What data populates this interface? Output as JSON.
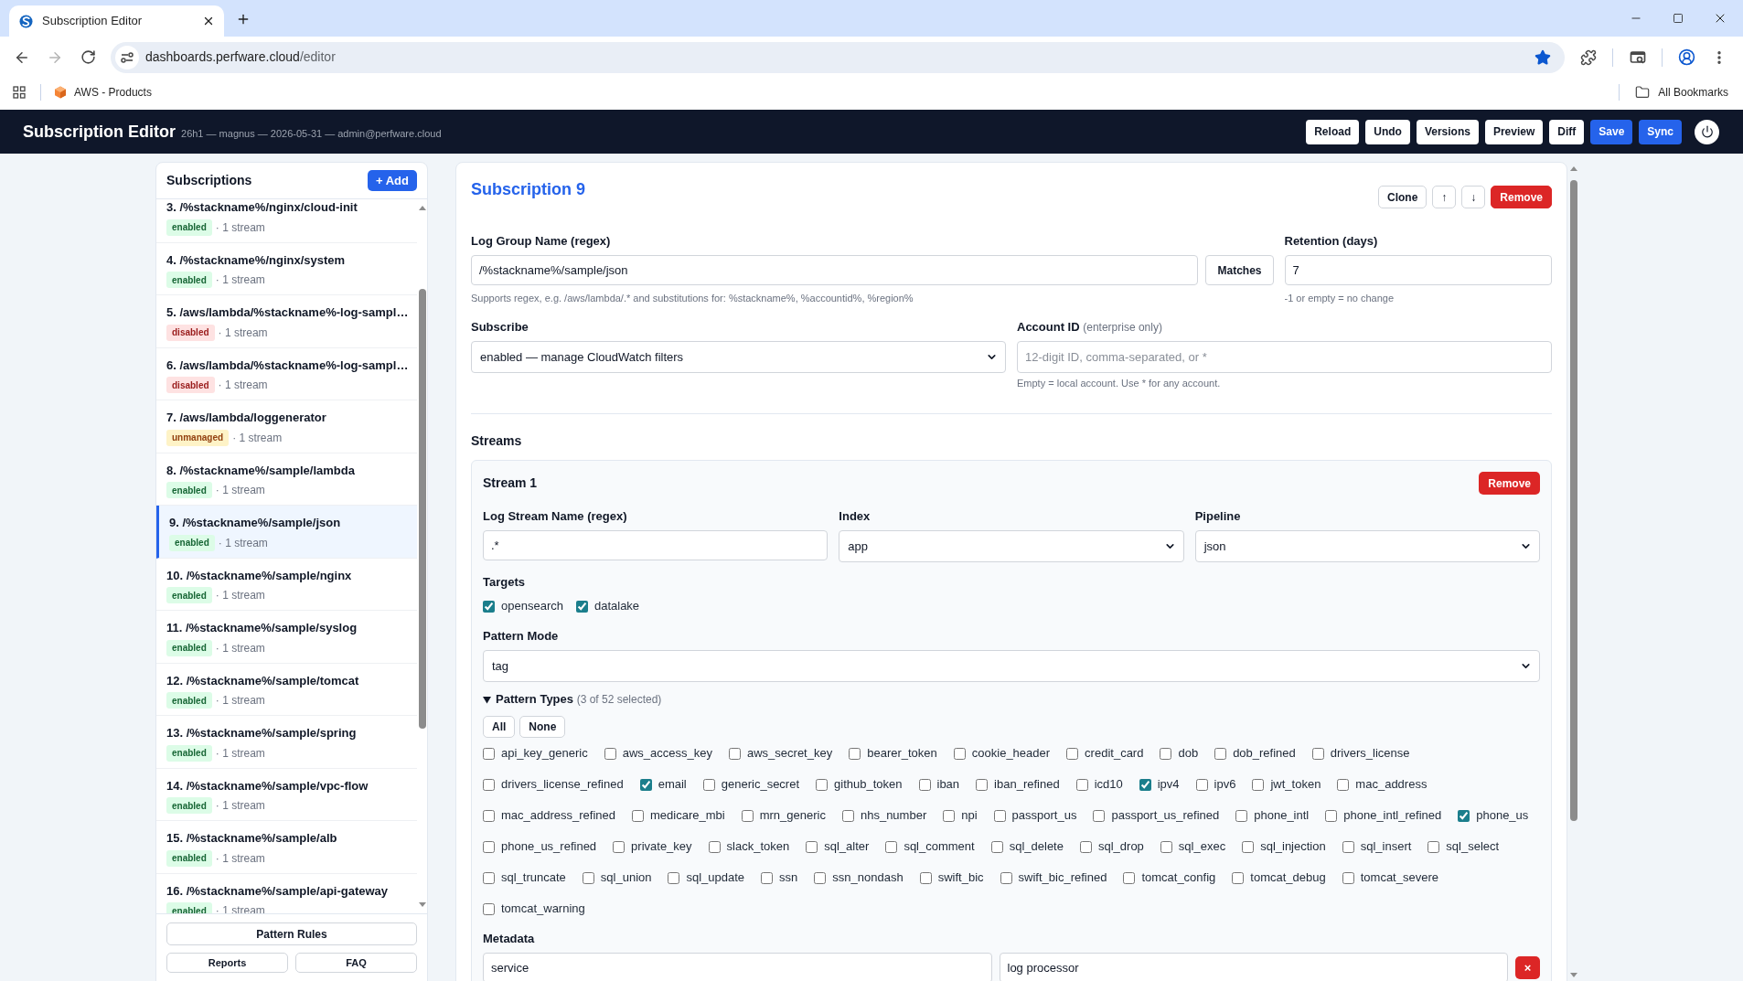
{
  "browser": {
    "tab": {
      "title": "Subscription Editor",
      "selected": true
    },
    "forward_disabled": true,
    "address": {
      "host": "dashboards.perfware.cloud",
      "path": "/editor"
    },
    "bookmarked": true,
    "bookmarks": [
      "AWS - Products"
    ],
    "all_bookmarks": "All Bookmarks"
  },
  "header": {
    "title": "Subscription Editor",
    "meta": "26h1 — magnus — 2026-05-31 — admin@perfware.cloud",
    "buttons": [
      {
        "label": "Reload",
        "kind": "secondary"
      },
      {
        "label": "Undo",
        "kind": "secondary"
      },
      {
        "label": "Versions",
        "kind": "secondary"
      },
      {
        "label": "Preview",
        "kind": "secondary"
      },
      {
        "label": "Diff",
        "kind": "secondary"
      },
      {
        "label": "Save",
        "kind": "primary"
      },
      {
        "label": "Sync",
        "kind": "primary"
      }
    ]
  },
  "sidebar": {
    "title": "Subscriptions",
    "add_button": "+ Add",
    "items": [
      {
        "title": "3. /%stackname%/nginx/cloud-init",
        "status": {
          "label": "enabled",
          "kind": "success"
        },
        "streams": "· 1 stream",
        "selected": false
      },
      {
        "title": "4. /%stackname%/nginx/system",
        "status": {
          "label": "enabled",
          "kind": "success"
        },
        "streams": "· 1 stream",
        "selected": false
      },
      {
        "title": "5. /aws/lambda/%stackname%-log-sampl…",
        "status": {
          "label": "disabled",
          "kind": "danger"
        },
        "streams": "· 1 stream",
        "selected": false
      },
      {
        "title": "6. /aws/lambda/%stackname%-log-sampl…",
        "status": {
          "label": "disabled",
          "kind": "danger"
        },
        "streams": "· 1 stream",
        "selected": false
      },
      {
        "title": "7. /aws/lambda/loggenerator",
        "status": {
          "label": "unmanaged",
          "kind": "warning"
        },
        "streams": "· 1 stream",
        "selected": false
      },
      {
        "title": "8. /%stackname%/sample/lambda",
        "status": {
          "label": "enabled",
          "kind": "success"
        },
        "streams": "· 1 stream",
        "selected": false
      },
      {
        "title": "9. /%stackname%/sample/json",
        "status": {
          "label": "enabled",
          "kind": "success"
        },
        "streams": "· 1 stream",
        "selected": true
      },
      {
        "title": "10. /%stackname%/sample/nginx",
        "status": {
          "label": "enabled",
          "kind": "success"
        },
        "streams": "· 1 stream",
        "selected": false
      },
      {
        "title": "11. /%stackname%/sample/syslog",
        "status": {
          "label": "enabled",
          "kind": "success"
        },
        "streams": "· 1 stream",
        "selected": false
      },
      {
        "title": "12. /%stackname%/sample/tomcat",
        "status": {
          "label": "enabled",
          "kind": "success"
        },
        "streams": "· 1 stream",
        "selected": false
      },
      {
        "title": "13. /%stackname%/sample/spring",
        "status": {
          "label": "enabled",
          "kind": "success"
        },
        "streams": "· 1 stream",
        "selected": false
      },
      {
        "title": "14. /%stackname%/sample/vpc-flow",
        "status": {
          "label": "enabled",
          "kind": "success"
        },
        "streams": "· 1 stream",
        "selected": false
      },
      {
        "title": "15. /%stackname%/sample/alb",
        "status": {
          "label": "enabled",
          "kind": "success"
        },
        "streams": "· 1 stream",
        "selected": false
      },
      {
        "title": "16. /%stackname%/sample/api-gateway",
        "status": {
          "label": "enabled",
          "kind": "success"
        },
        "streams": "· 1 stream",
        "selected": false
      }
    ],
    "footer_buttons": [
      "Pattern Rules",
      "Reports",
      "FAQ"
    ]
  },
  "editor": {
    "title": "Subscription 9",
    "actions": [
      {
        "label": "Clone",
        "kind": "secondary"
      },
      {
        "label": "↑",
        "kind": "secondary"
      },
      {
        "label": "↓",
        "kind": "secondary"
      },
      {
        "label": "Remove",
        "kind": "danger"
      }
    ],
    "log_group": {
      "label": "Log Group Name (regex)",
      "value": "/%stackname%/sample/json",
      "button": "Matches",
      "help": "Supports regex, e.g. /aws/lambda/.* and substitutions for: %stackname%, %accountid%, %region%"
    },
    "retention": {
      "label": "Retention (days)",
      "value": "7",
      "help": "-1 or empty = no change"
    },
    "subscribe": {
      "label": "Subscribe",
      "value": "enabled — manage CloudWatch filters"
    },
    "account_id": {
      "label": "Account ID",
      "note": "(enterprise only)",
      "placeholder": "12-digit ID, comma-separated, or *",
      "help": "Empty = local account. Use * for any account."
    },
    "streams": {
      "title": "Streams",
      "items": [
        {
          "title": "Stream 1",
          "remove": "Remove",
          "log_stream": {
            "label": "Log Stream Name (regex)",
            "value": ".*"
          },
          "index": {
            "label": "Index",
            "value": "app"
          },
          "pipeline": {
            "label": "Pipeline",
            "value": "json"
          },
          "targets": {
            "label": "Targets",
            "options": [
              {
                "label": "opensearch",
                "checked": true
              },
              {
                "label": "datalake",
                "checked": true
              }
            ]
          },
          "pattern_mode": {
            "label": "Pattern Mode",
            "value": "tag"
          },
          "pattern_types": {
            "label": "Pattern Types",
            "count": "(3 of 52 selected)",
            "expanded": true,
            "buttons": [
              "All",
              "None"
            ],
            "options": [
              {
                "label": "api_key_generic",
                "checked": false
              },
              {
                "label": "aws_access_key",
                "checked": false
              },
              {
                "label": "aws_secret_key",
                "checked": false
              },
              {
                "label": "bearer_token",
                "checked": false
              },
              {
                "label": "cookie_header",
                "checked": false
              },
              {
                "label": "credit_card",
                "checked": false
              },
              {
                "label": "dob",
                "checked": false
              },
              {
                "label": "dob_refined",
                "checked": false
              },
              {
                "label": "drivers_license",
                "checked": false
              },
              {
                "label": "drivers_license_refined",
                "checked": false
              },
              {
                "label": "email",
                "checked": true
              },
              {
                "label": "generic_secret",
                "checked": false
              },
              {
                "label": "github_token",
                "checked": false
              },
              {
                "label": "iban",
                "checked": false
              },
              {
                "label": "iban_refined",
                "checked": false
              },
              {
                "label": "icd10",
                "checked": false
              },
              {
                "label": "ipv4",
                "checked": true
              },
              {
                "label": "ipv6",
                "checked": false
              },
              {
                "label": "jwt_token",
                "checked": false
              },
              {
                "label": "mac_address",
                "checked": false
              },
              {
                "label": "mac_address_refined",
                "checked": false
              },
              {
                "label": "medicare_mbi",
                "checked": false
              },
              {
                "label": "mrn_generic",
                "checked": false
              },
              {
                "label": "nhs_number",
                "checked": false
              },
              {
                "label": "npi",
                "checked": false
              },
              {
                "label": "passport_us",
                "checked": false
              },
              {
                "label": "passport_us_refined",
                "checked": false
              },
              {
                "label": "phone_intl",
                "checked": false
              },
              {
                "label": "phone_intl_refined",
                "checked": false
              },
              {
                "label": "phone_us",
                "checked": true
              },
              {
                "label": "phone_us_refined",
                "checked": false
              },
              {
                "label": "private_key",
                "checked": false
              },
              {
                "label": "slack_token",
                "checked": false
              },
              {
                "label": "sql_alter",
                "checked": false
              },
              {
                "label": "sql_comment",
                "checked": false
              },
              {
                "label": "sql_delete",
                "checked": false
              },
              {
                "label": "sql_drop",
                "checked": false
              },
              {
                "label": "sql_exec",
                "checked": false
              },
              {
                "label": "sql_injection",
                "checked": false
              },
              {
                "label": "sql_insert",
                "checked": false
              },
              {
                "label": "sql_select",
                "checked": false
              },
              {
                "label": "sql_truncate",
                "checked": false
              },
              {
                "label": "sql_union",
                "checked": false
              },
              {
                "label": "sql_update",
                "checked": false
              },
              {
                "label": "ssn",
                "checked": false
              },
              {
                "label": "ssn_nondash",
                "checked": false
              },
              {
                "label": "swift_bic",
                "checked": false
              },
              {
                "label": "swift_bic_refined",
                "checked": false
              },
              {
                "label": "tomcat_config",
                "checked": false
              },
              {
                "label": "tomcat_debug",
                "checked": false
              },
              {
                "label": "tomcat_severe",
                "checked": false
              },
              {
                "label": "tomcat_warning",
                "checked": false
              }
            ]
          },
          "metadata": {
            "label": "Metadata",
            "rows": [
              {
                "key": "service",
                "value": "log processor",
                "remove": "×"
              }
            ]
          }
        }
      ]
    }
  }
}
